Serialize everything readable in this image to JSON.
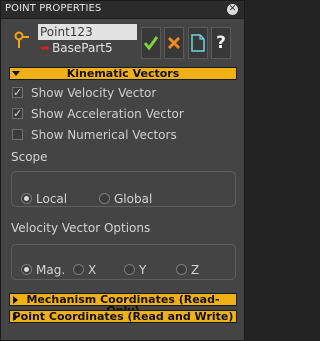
{
  "window": {
    "title": "POINT PROPERTIES"
  },
  "tree": {
    "selected": "Point123",
    "child": "BasePart5"
  },
  "toolbar": {
    "buttons": [
      "check-icon",
      "cancel-icon",
      "document-icon",
      "help-icon"
    ],
    "help_label": "?"
  },
  "kinematic": {
    "header": "Kinematic Vectors",
    "checks": [
      {
        "label": "Show Velocity Vector",
        "checked": true
      },
      {
        "label": "Show Acceleration Vector",
        "checked": true
      },
      {
        "label": "Show Numerical Vectors",
        "checked": false
      }
    ]
  },
  "scope": {
    "label": "Scope",
    "options": [
      "Local",
      "Global"
    ],
    "selected": "Local"
  },
  "velocity_options": {
    "label": "Velocity Vector Options",
    "options": [
      "Mag.",
      "X",
      "Y",
      "Z"
    ],
    "selected": "Mag."
  },
  "sections": {
    "mechanism": "Mechanism Coordinates (Read-Only)",
    "point": "Point Coordinates (Read and Write)"
  },
  "colors": {
    "accent": "#f0b116",
    "check_green": "#7fd13a",
    "cancel_orange": "#ee8a1a",
    "panel": "#444444"
  }
}
